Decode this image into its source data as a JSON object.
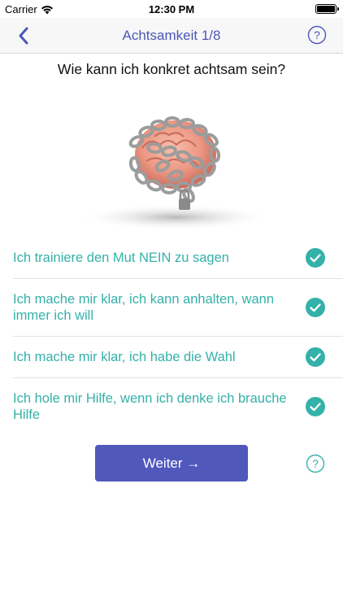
{
  "status": {
    "carrier": "Carrier",
    "time": "12:30 PM"
  },
  "nav": {
    "title": "Achtsamkeit 1/8",
    "back_icon": "chevron-left-icon",
    "help_icon": "question-circle-icon"
  },
  "question": "Wie kann ich konkret achtsam sein?",
  "illustration": "brain-in-chains-image",
  "items": [
    {
      "label": "Ich trainiere den Mut NEIN zu sagen",
      "checked": true
    },
    {
      "label": "Ich mache mir klar, ich kann anhalten, wann immer ich will",
      "checked": true
    },
    {
      "label": "Ich mache mir klar, ich habe die Wahl",
      "checked": true
    },
    {
      "label": "Ich hole mir Hilfe, wenn ich denke ich brauche Hilfe",
      "checked": true
    }
  ],
  "next_button": "Weiter →",
  "colors": {
    "accent": "#5058bb",
    "teal": "#34b1a9",
    "nav_title": "#4c57b8"
  }
}
